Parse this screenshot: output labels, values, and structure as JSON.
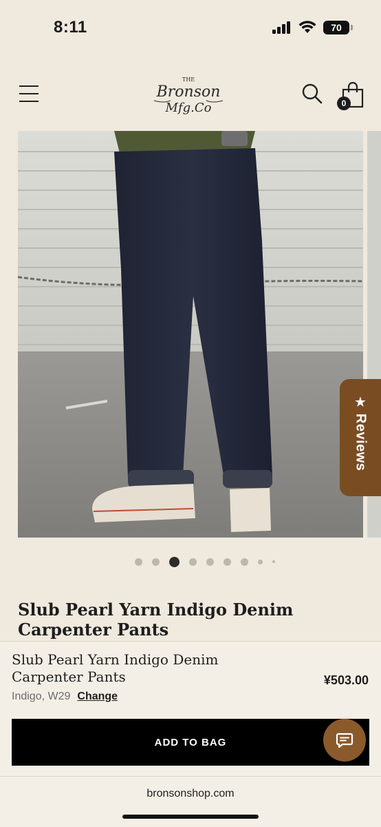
{
  "status_bar": {
    "time": "8:11",
    "battery": "70"
  },
  "header": {
    "brand_logo_text": "THE BRONSON MFG. Co",
    "bag_count": "0"
  },
  "gallery": {
    "image_count": 9,
    "active_index": 2,
    "reviews_label": "Reviews"
  },
  "product": {
    "title": "Slub Pearl Yarn Indigo Denim Carpenter Pants"
  },
  "sticky_bar": {
    "title": "Slub Pearl Yarn Indigo Denim Carpenter Pants",
    "variant": "Indigo, W29",
    "change_label": "Change",
    "price": "¥503.00",
    "add_to_bag_label": "ADD TO BAG"
  },
  "browser": {
    "url": "bronsonshop.com"
  },
  "colors": {
    "background": "#efe9de",
    "reviews_tab": "#7a4c22",
    "chat_button": "#8a5a2b",
    "primary_button": "#000000"
  }
}
